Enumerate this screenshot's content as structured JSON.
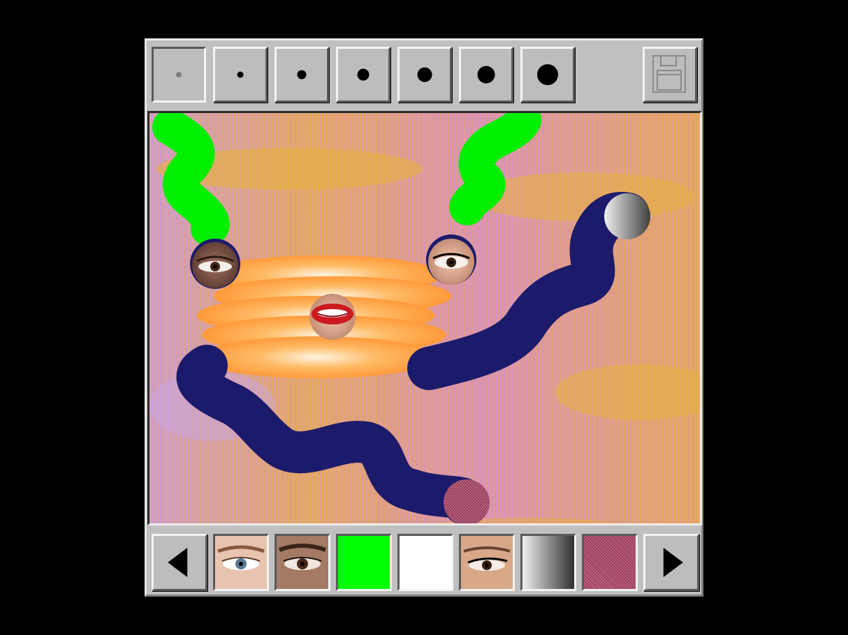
{
  "app": {
    "name": "paint-window"
  },
  "toolbar": {
    "brush_sizes": [
      {
        "name": "brush-size-1",
        "level": 1
      },
      {
        "name": "brush-size-2",
        "level": 2
      },
      {
        "name": "brush-size-3",
        "level": 3
      },
      {
        "name": "brush-size-4",
        "level": 4
      },
      {
        "name": "brush-size-5",
        "level": 5
      },
      {
        "name": "brush-size-6",
        "level": 6
      },
      {
        "name": "brush-size-7",
        "level": 7
      }
    ],
    "selected_brush_level": 1,
    "save_icon": "floppy-disk-icon"
  },
  "palette": {
    "prev_icon": "triangle-left-icon",
    "next_icon": "triangle-right-icon",
    "swatches": [
      {
        "name": "swatch-eye-blue",
        "kind": "photo-eye"
      },
      {
        "name": "swatch-eye-brown",
        "kind": "photo-eye"
      },
      {
        "name": "swatch-green",
        "kind": "color",
        "color": "#00ff00"
      },
      {
        "name": "swatch-white",
        "kind": "color",
        "color": "#ffffff"
      },
      {
        "name": "swatch-eye-lined",
        "kind": "photo-eye"
      },
      {
        "name": "swatch-gray-gradient",
        "kind": "gradient"
      },
      {
        "name": "swatch-pink-texture",
        "kind": "texture",
        "color": "#b05070"
      }
    ]
  },
  "colors": {
    "window": "#c0c0c0",
    "stroke_navy": "#1c1a6b",
    "stroke_green": "#00ee00",
    "background_pink": "#d890c0",
    "background_yellow": "#e8b040",
    "orange_blob": "#ffa040"
  }
}
